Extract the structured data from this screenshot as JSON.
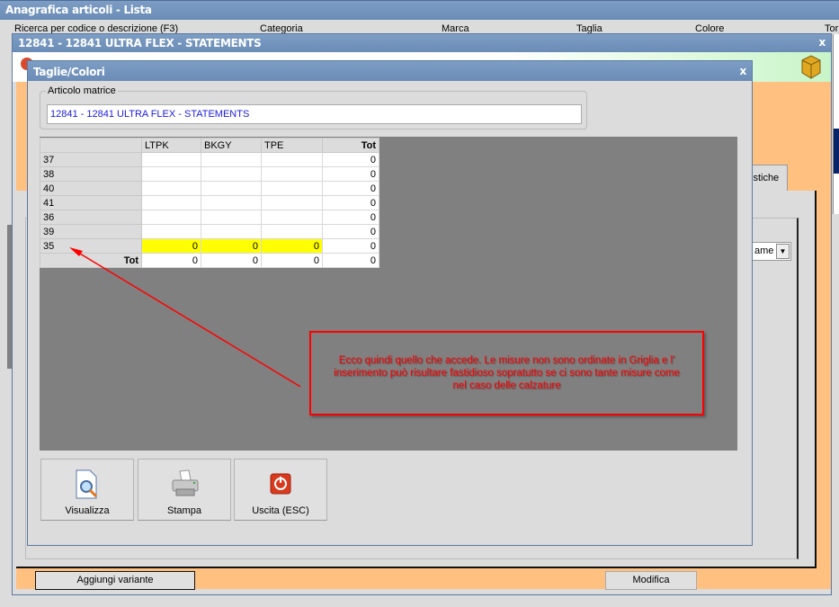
{
  "main_window": {
    "title": "Anagrafica articoli  - Lista",
    "filters": [
      "Ricerca per codice o descrizione (F3)",
      "Categoria",
      "Marca",
      "Taglia",
      "Colore",
      "Tor"
    ]
  },
  "article_window": {
    "title": "12841 - 12841  ULTRA FLEX - STATEMENTS",
    "close_label": "x",
    "tab_partial": "istiche",
    "combo_partial": "ame",
    "add_variant_button": "Aggiungi variante",
    "edit_button": "Modifica"
  },
  "dialog": {
    "title": "Taglie/Colori",
    "close_label": "x",
    "group_label": "Articolo matrice",
    "article_value": "12841 - 12841  ULTRA FLEX - STATEMENTS",
    "grid": {
      "columns": [
        "LTPK",
        "BKGY",
        "TPE",
        "Tot"
      ],
      "rows": [
        {
          "size": "37",
          "cells": [
            "",
            "",
            ""
          ],
          "tot": "0",
          "highlight": false
        },
        {
          "size": "38",
          "cells": [
            "",
            "",
            ""
          ],
          "tot": "0",
          "highlight": false
        },
        {
          "size": "40",
          "cells": [
            "",
            "",
            ""
          ],
          "tot": "0",
          "highlight": false
        },
        {
          "size": "41",
          "cells": [
            "",
            "",
            ""
          ],
          "tot": "0",
          "highlight": false
        },
        {
          "size": "36",
          "cells": [
            "",
            "",
            ""
          ],
          "tot": "0",
          "highlight": false
        },
        {
          "size": "39",
          "cells": [
            "",
            "",
            ""
          ],
          "tot": "0",
          "highlight": false
        },
        {
          "size": "35",
          "cells": [
            "0",
            "0",
            "0"
          ],
          "tot": "0",
          "highlight": true
        }
      ],
      "total_row": {
        "label": "Tot",
        "cells": [
          "0",
          "0",
          "0"
        ],
        "tot": "0"
      }
    },
    "buttons": [
      {
        "label": "Visualizza",
        "icon": "preview-icon"
      },
      {
        "label": "Stampa",
        "icon": "printer-icon"
      },
      {
        "label": "Uscita (ESC)",
        "icon": "power-icon"
      }
    ]
  },
  "annotation": {
    "text": "Ecco quindi quello che accede. Le misure non sono ordinate in Griglia e l' inserimento può risultare fastidioso sopratutto se ci sono tante misure come nel caso delle calzature",
    "color": "#ff0000"
  },
  "colors": {
    "titlebar": "#6f91bb",
    "panel": "#ffc080",
    "highlight": "#ffff00",
    "grid_bg": "#808080"
  }
}
